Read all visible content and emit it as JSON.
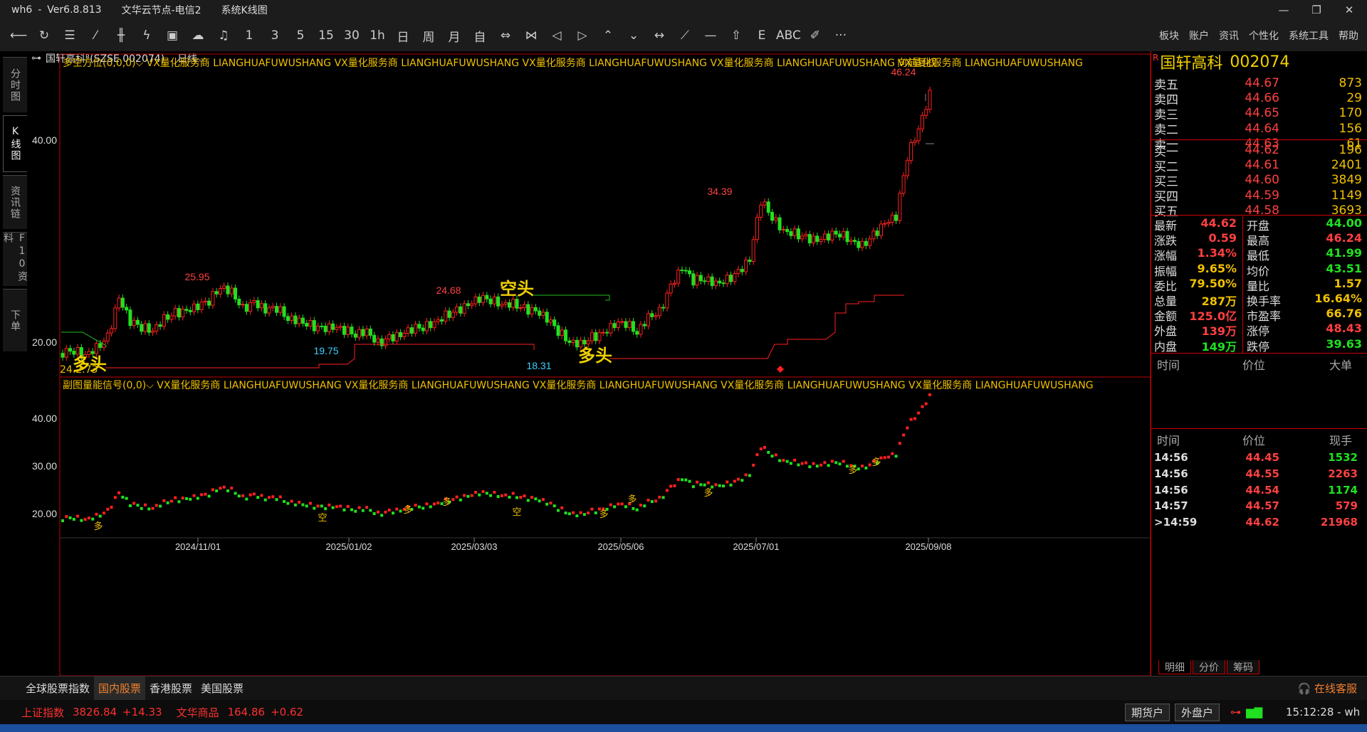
{
  "titlebar": {
    "app": "wh6",
    "sep": "-",
    "version": "Ver6.8.813",
    "node": "文华云节点-电信2",
    "view": "系统K线图",
    "min": "—",
    "max": "❐",
    "close": "✕"
  },
  "toolbar": {
    "buttons": [
      {
        "name": "back-icon",
        "glyph": "⟵"
      },
      {
        "name": "refresh-icon",
        "glyph": "↻"
      },
      {
        "name": "list-icon",
        "glyph": "☰"
      },
      {
        "name": "line-chart-icon",
        "glyph": "⁄"
      },
      {
        "name": "candle-icon",
        "glyph": "╫"
      },
      {
        "name": "tick-icon",
        "glyph": "ϟ"
      },
      {
        "name": "screen-icon",
        "glyph": "▣"
      },
      {
        "name": "cloud-icon",
        "glyph": "☁"
      },
      {
        "name": "bell-icon",
        "glyph": "♫"
      },
      {
        "name": "period-1m",
        "glyph": "1"
      },
      {
        "name": "period-3m",
        "glyph": "3"
      },
      {
        "name": "period-5m",
        "glyph": "5"
      },
      {
        "name": "period-15m",
        "glyph": "15"
      },
      {
        "name": "period-30m",
        "glyph": "30"
      },
      {
        "name": "period-1h",
        "glyph": "1h"
      },
      {
        "name": "period-day",
        "glyph": "日"
      },
      {
        "name": "period-week",
        "glyph": "周"
      },
      {
        "name": "period-month",
        "glyph": "月"
      },
      {
        "name": "period-custom",
        "glyph": "自"
      },
      {
        "name": "zoom-in-icon",
        "glyph": "⇔"
      },
      {
        "name": "zoom-out-icon",
        "glyph": "⋈"
      },
      {
        "name": "prev-icon",
        "glyph": "◁"
      },
      {
        "name": "next-icon",
        "glyph": "▷"
      },
      {
        "name": "up-icon",
        "glyph": "⌃"
      },
      {
        "name": "down-icon",
        "glyph": "⌄"
      },
      {
        "name": "crosshair-icon",
        "glyph": "↔"
      },
      {
        "name": "draw-line-icon",
        "glyph": "⟋"
      },
      {
        "name": "hline-icon",
        "glyph": "—"
      },
      {
        "name": "arrow-up-icon",
        "glyph": "⇧"
      },
      {
        "name": "fib-icon",
        "glyph": "E"
      },
      {
        "name": "text-icon",
        "glyph": "ABC"
      },
      {
        "name": "eraser-icon",
        "glyph": "✐"
      },
      {
        "name": "more-icon",
        "glyph": "···"
      }
    ],
    "menus": [
      "板块",
      "账户",
      "资讯",
      "个性化",
      "系统工具",
      "帮助"
    ]
  },
  "leftnav": [
    {
      "label": "分时图",
      "active": false
    },
    {
      "label": "K线图",
      "active": true
    },
    {
      "label": "资讯链",
      "active": false
    },
    {
      "label": "F10资料",
      "active": false
    },
    {
      "label": "下单",
      "active": false
    }
  ],
  "chart_header": {
    "stock": "国轩高科ᴿ(SZSE 002074)",
    "period": "日线⌵"
  },
  "main_indicator": {
    "label": "多空方位(0,0,0)⌵",
    "text": "VX量化服务商  LIANGHUAFUWUSHANG  VX量化服务商  LIANGHUAFUWUSHANG  VX量化服务商  LIANGHUAFUWUSHANG  VX量化服务商  LIANGHUAFUWUSHANG  VX量化服务商  LIANGHUAFUWUSHANG",
    "adj": "向前复权"
  },
  "sub_indicator": {
    "label": "副图量能信号(0,0)⌵",
    "text": "VX量化服务商  LIANGHUAFUWUSHANG  VX量化服务商  LIANGHUAFUWUSHANG  VX量化服务商  LIANGHUAFUWUSHANG  VX量化服务商  LIANGHUAFUWUSHANG  VX量化服务商  LIANGHUAFUWUSHANG"
  },
  "annotations": {
    "short": "空头",
    "long1": "多头",
    "long2": "多头",
    "low_values": "24.2.73"
  },
  "chart_data": [
    {
      "type": "candlestick",
      "title": "",
      "y_ticks": [
        "40.00",
        "20.00"
      ],
      "x_ticks": [
        "2024/11/01",
        "2025/01/02",
        "2025/03/03",
        "2025/05/06",
        "2025/07/01",
        "2025/09/08"
      ],
      "labeled_points": [
        {
          "label": "25.95",
          "value": 25.95
        },
        {
          "label": "24.68",
          "value": 24.68
        },
        {
          "label": "19.75",
          "value": 19.75
        },
        {
          "label": "18.31",
          "value": 18.31
        },
        {
          "label": "34.39",
          "value": 34.39
        },
        {
          "label": "46.24",
          "value": 46.24
        }
      ],
      "series": [
        {
          "values": [
            18.9,
            19.2,
            18.8,
            19.5,
            20.5,
            24.3,
            22.0,
            21.5,
            21.2,
            22.4,
            22.9,
            23.0,
            23.5,
            24.1,
            25.5,
            25.1,
            23.3,
            23.9,
            23.1,
            23.4,
            22.4,
            22.2,
            21.7,
            21.3,
            21.4,
            21.2,
            20.8,
            21.2,
            19.9,
            20.4,
            20.6,
            21.3,
            21.5,
            22.0,
            22.7,
            23.1,
            23.6,
            24.3,
            24.2,
            23.8,
            23.9,
            23.3,
            23.0,
            22.3,
            21.1,
            20.1,
            19.9,
            20.5,
            20.8,
            21.7,
            21.9,
            21.0,
            22.6,
            23.0,
            25.5,
            27.3,
            26.1,
            26.3,
            25.9,
            26.2,
            26.9,
            28.1,
            34.0,
            32.4,
            31.1,
            30.8,
            30.3,
            30.0,
            30.5,
            30.8,
            30.1,
            29.6,
            30.6,
            31.7,
            32.4,
            38.4,
            41.2,
            44.62
          ]
        }
      ],
      "notes": "values are approximate closing prices read from the chart"
    },
    {
      "type": "line",
      "title": "",
      "y_ticks": [
        "40.00",
        "30.00",
        "20.00"
      ],
      "signals": [
        "多",
        "多",
        "空",
        "空",
        "多",
        "多",
        "多",
        "多",
        "多",
        "多"
      ]
    }
  ],
  "quote": {
    "name": "国轩高科",
    "code": "002074",
    "asks": [
      {
        "label": "卖五",
        "price": "44.67",
        "vol": "873"
      },
      {
        "label": "卖四",
        "price": "44.66",
        "vol": "29"
      },
      {
        "label": "卖三",
        "price": "44.65",
        "vol": "170"
      },
      {
        "label": "卖二",
        "price": "44.64",
        "vol": "156"
      },
      {
        "label": "卖一",
        "price": "44.63",
        "vol": "61"
      }
    ],
    "bids": [
      {
        "label": "买一",
        "price": "44.62",
        "vol": "196"
      },
      {
        "label": "买二",
        "price": "44.61",
        "vol": "2401"
      },
      {
        "label": "买三",
        "price": "44.60",
        "vol": "3849"
      },
      {
        "label": "买四",
        "price": "44.59",
        "vol": "1149"
      },
      {
        "label": "买五",
        "price": "44.58",
        "vol": "3693"
      }
    ],
    "stats": [
      {
        "k1": "最新",
        "v1": "44.62",
        "c1": "#ff4040",
        "k2": "开盘",
        "v2": "44.00",
        "c2": "#20e020"
      },
      {
        "k1": "涨跌",
        "v1": "0.59",
        "c1": "#ff4040",
        "k2": "最高",
        "v2": "46.24",
        "c2": "#ff4040"
      },
      {
        "k1": "涨幅",
        "v1": "1.34%",
        "c1": "#ff4040",
        "k2": "最低",
        "v2": "41.99",
        "c2": "#20e020"
      },
      {
        "k1": "振幅",
        "v1": "9.65%",
        "c1": "#f0c000",
        "k2": "均价",
        "v2": "43.51",
        "c2": "#20e020"
      },
      {
        "k1": "委比",
        "v1": "79.50%",
        "c1": "#f0c000",
        "k2": "量比",
        "v2": "1.57",
        "c2": "#f0c000"
      },
      {
        "k1": "总量",
        "v1": "287万",
        "c1": "#f0c000",
        "k2": "换手率",
        "v2": "16.64%",
        "c2": "#f0c000"
      },
      {
        "k1": "金额",
        "v1": "125.0亿",
        "c1": "#ff4040",
        "k2": "市盈率",
        "v2": "66.76",
        "c2": "#f0c000"
      },
      {
        "k1": "外盘",
        "v1": "139万",
        "c1": "#ff4040",
        "k2": "涨停",
        "v2": "48.43",
        "c2": "#ff4040"
      },
      {
        "k1": "内盘",
        "v1": "149万",
        "c1": "#20e020",
        "k2": "跌停",
        "v2": "39.63",
        "c2": "#20e020"
      }
    ],
    "bigorders_header": [
      "时间",
      "价位",
      "大单"
    ],
    "ticks_header": [
      "时间",
      "价位",
      "现手"
    ],
    "ticks": [
      {
        "t": "14:56",
        "p": "44.45",
        "v": "1532",
        "vc": "#20e020"
      },
      {
        "t": "14:56",
        "p": "44.55",
        "v": "2263",
        "vc": "#ff4040"
      },
      {
        "t": "14:56",
        "p": "44.54",
        "v": "1174",
        "vc": "#20e020"
      },
      {
        "t": "14:57",
        "p": "44.57",
        "v": "579",
        "vc": "#ff4040"
      },
      {
        "t": ">14:59",
        "p": "44.62",
        "v": "21968",
        "vc": "#ff4040"
      }
    ],
    "tabs": [
      "明细",
      "分价",
      "筹码"
    ]
  },
  "bottomtabs": [
    {
      "label": "全球股票指数",
      "active": false
    },
    {
      "label": "国内股票",
      "active": true
    },
    {
      "label": "香港股票",
      "active": false
    },
    {
      "label": "美国股票",
      "active": false
    }
  ],
  "service": "在线客服",
  "status": {
    "idx1_name": "上证指数",
    "idx1_val": "3826.84",
    "idx1_chg": "+14.33",
    "idx2_name": "文华商品",
    "idx2_val": "164.86",
    "idx2_chg": "+0.62",
    "btn1": "期货户",
    "btn2": "外盘户",
    "time": "15:12:28 - wh"
  },
  "colors": {
    "up": "#ff2020",
    "down": "#20e020",
    "label": "#f0c000",
    "axis": "#c00000",
    "cyan": "#40d0ff"
  }
}
